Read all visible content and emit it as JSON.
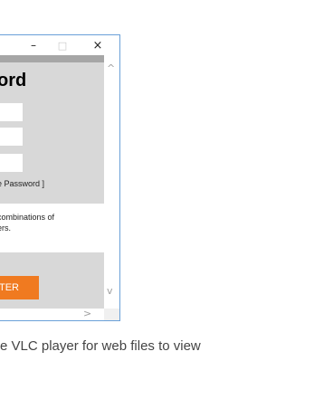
{
  "window": {
    "controls": {
      "minimize": "–",
      "maximize": "□",
      "close": "×"
    },
    "heading": "ord",
    "show_password_link": "e Password ]",
    "hint_lines": [
      "combinations of",
      "ers."
    ],
    "enter_button": "TER",
    "scroll": {
      "up": "^",
      "down": "v",
      "right": ">"
    }
  },
  "caption": "e VLC player for web files to view",
  "colors": {
    "accent": "#f07a20",
    "content_bg": "#d8d8d8",
    "window_border": "#6aa0d8"
  }
}
